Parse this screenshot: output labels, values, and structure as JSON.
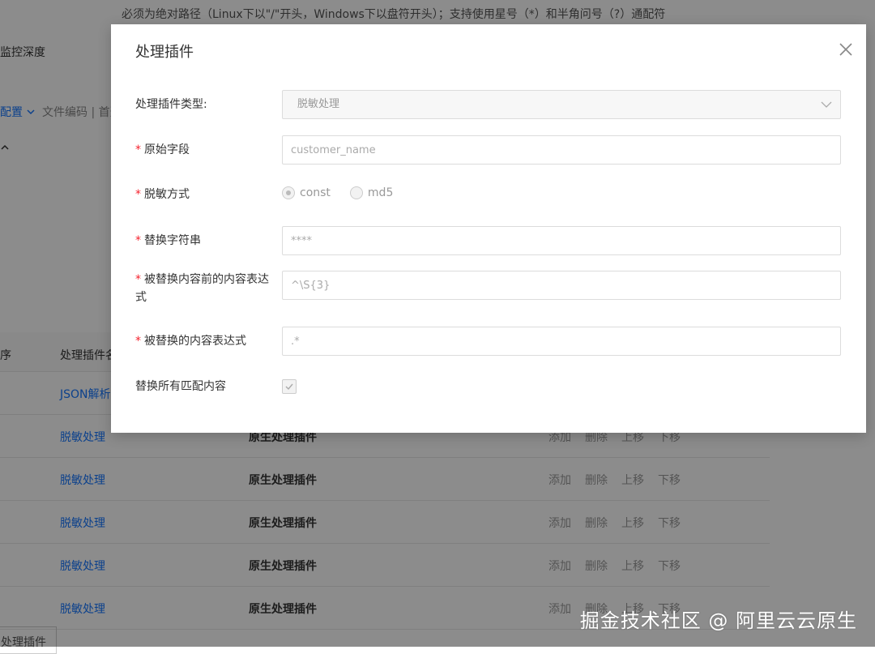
{
  "background": {
    "hint": "必须为绝对路径（Linux下以\"/\"开头，Windows下以盘符开头）；支持使用星号（*）和半角问号（?）通配符",
    "monitor_depth": "监控深度",
    "config_link": "配置",
    "config_rest": "文件编码 | 首选",
    "table": {
      "col_order": "序",
      "col_name": "处理插件名",
      "rows": [
        {
          "name": "JSON解析",
          "type": "",
          "actions": []
        },
        {
          "name": "脱敏处理",
          "type": "原生处理插件",
          "actions": [
            "添加",
            "删除",
            "上移",
            "下移"
          ]
        },
        {
          "name": "脱敏处理",
          "type": "原生处理插件",
          "actions": [
            "添加",
            "删除",
            "上移",
            "下移"
          ]
        },
        {
          "name": "脱敏处理",
          "type": "原生处理插件",
          "actions": [
            "添加",
            "删除",
            "上移",
            "下移"
          ]
        },
        {
          "name": "脱敏处理",
          "type": "原生处理插件",
          "actions": [
            "添加",
            "删除",
            "上移",
            "下移"
          ]
        },
        {
          "name": "脱敏处理",
          "type": "原生处理插件",
          "actions": [
            "添加",
            "删除",
            "上移",
            "下移"
          ]
        }
      ]
    },
    "add_plugin_button": "处理插件",
    "watermark": "掘金技术社区 @ 阿里云云原生"
  },
  "modal": {
    "title": "处理插件",
    "fields": {
      "plugin_type": {
        "label": "处理插件类型:",
        "value": "脱敏处理"
      },
      "source_field": {
        "label": "原始字段",
        "value": "customer_name"
      },
      "mask_method": {
        "label": "脱敏方式",
        "options": [
          "const",
          "md5"
        ],
        "selected": "const"
      },
      "replace_string": {
        "label": "替换字符串",
        "value": "****"
      },
      "prefix_regex": {
        "label_line1": "被替换内容前的内容表达",
        "label_line2": "式",
        "value": "^\\S{3}"
      },
      "content_regex": {
        "label": "被替换的内容表达式",
        "value": ".*"
      },
      "replace_all": {
        "label": "替换所有匹配内容",
        "checked": true
      }
    }
  }
}
